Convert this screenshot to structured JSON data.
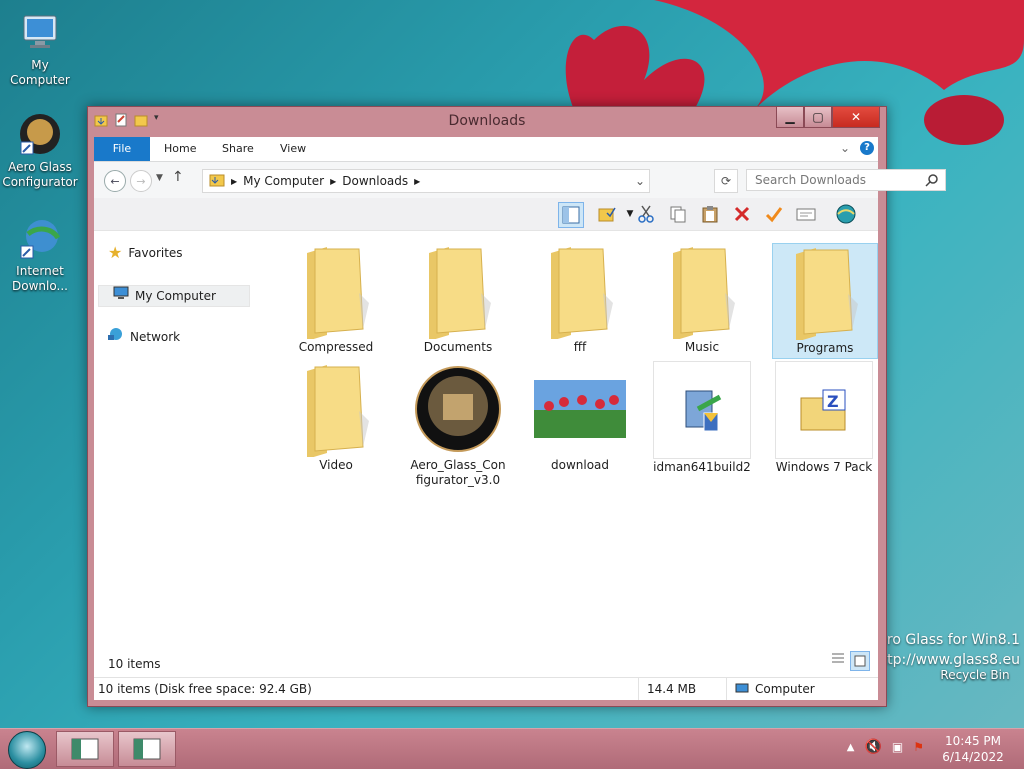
{
  "desktop": {
    "icons": [
      {
        "label": "My Computer"
      },
      {
        "label": "Aero Glass Configurator"
      },
      {
        "label": "Internet Downlo..."
      }
    ],
    "watermark_line1": "Aero Glass for Win8.1",
    "watermark_line2": "http://www.glass8.eu",
    "recycle_bin": "Recycle Bin"
  },
  "window": {
    "title": "Downloads",
    "tabs": {
      "file": "File",
      "home": "Home",
      "share": "Share",
      "view": "View"
    },
    "breadcrumb": [
      "My Computer",
      "Downloads"
    ],
    "search_placeholder": "Search Downloads",
    "nav": {
      "favorites": "Favorites",
      "my_computer": "My Computer",
      "network": "Network"
    },
    "items": [
      {
        "label": "Compressed",
        "kind": "folder"
      },
      {
        "label": "Documents",
        "kind": "folder"
      },
      {
        "label": "fff",
        "kind": "folder"
      },
      {
        "label": "Music",
        "kind": "folder"
      },
      {
        "label": "Programs",
        "kind": "folder"
      },
      {
        "label": "Video",
        "kind": "folder"
      },
      {
        "label": "Aero_Glass_Configurator_v3.0",
        "kind": "app"
      },
      {
        "label": "download",
        "kind": "image"
      },
      {
        "label": "idman641build2",
        "kind": "installer"
      },
      {
        "label": "Windows 7 Pack",
        "kind": "archive"
      }
    ],
    "item_count": "10 items",
    "status": {
      "left": "10 items (Disk free space: 92.4 GB)",
      "size": "14.4 MB",
      "location": "Computer"
    }
  },
  "taskbar": {
    "time": "10:45 PM",
    "date": "6/14/2022"
  },
  "colors": {
    "accent": "#1979ca",
    "window_frame": "#c98c95",
    "selection": "#cde8f7"
  }
}
